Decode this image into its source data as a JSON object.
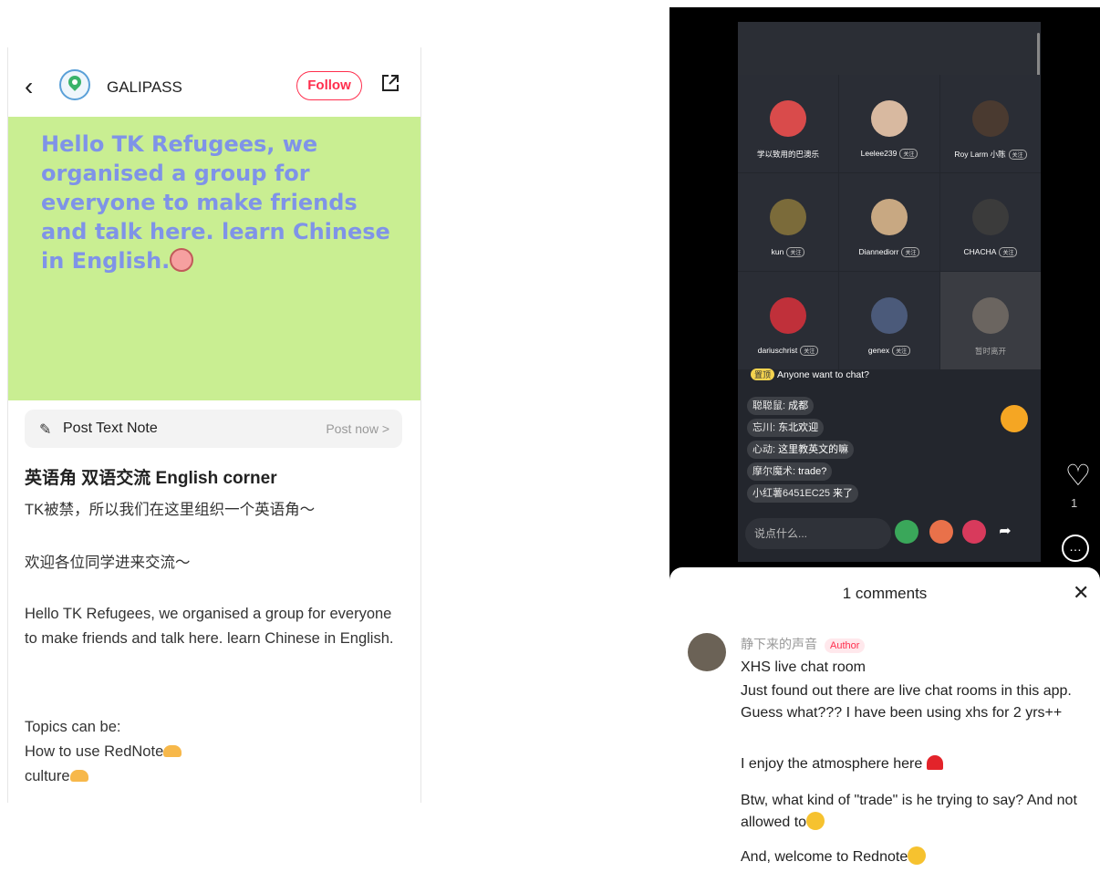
{
  "left": {
    "brand": "GALIPASS",
    "follow_label": "Follow",
    "banner_text": "Hello TK Refugees, we organised a group for everyone to make friends and talk here. learn Chinese in English.",
    "post_label": "Post Text Note",
    "post_now": "Post now >",
    "title": "英语角 双语交流 English corner",
    "p1": "TK被禁，所以我们在这里组织一个英语角～",
    "p2": "欢迎各位同学进来交流～",
    "p3": "Hello TK Refugees, we organised a group for everyone to make friends and talk here. learn Chinese in English.",
    "p4a": "Topics can be:",
    "p4b": "How to use RedNote",
    "p4c": "culture"
  },
  "live": {
    "tiles": [
      {
        "name": "学以致用的巴澳乐",
        "tag": ""
      },
      {
        "name": "Leelee239",
        "tag": "关注"
      },
      {
        "name": "Roy Larm 小陈",
        "tag": "关注"
      },
      {
        "name": "kun",
        "tag": "关注"
      },
      {
        "name": "Diannediorr",
        "tag": "关注"
      },
      {
        "name": "CHACHA",
        "tag": "关注"
      },
      {
        "name": "dariuschrist",
        "tag": "关注"
      },
      {
        "name": "genex",
        "tag": "关注"
      },
      {
        "name": "暂时离开",
        "tag": ""
      }
    ],
    "pin_badge": "置顶",
    "pinned": "Anyone want to chat?",
    "messages": [
      {
        "who": "聪聪鼠:",
        "text": " 成都"
      },
      {
        "who": "忘川:",
        "text": " 东北欢迎"
      },
      {
        "who": "心动:",
        "text": " 这里教英文的嘛"
      },
      {
        "who": "摩尔魔术:",
        "text": " trade?"
      },
      {
        "who": "小红薯6451EC25",
        "text": " 来了"
      }
    ],
    "input_placeholder": "说点什么...",
    "like_count": "1"
  },
  "comments": {
    "title": "1 comments",
    "author_name": "静下来的声音",
    "author_badge": "Author",
    "lines": [
      "XHS live chat room",
      "Just found out there are live chat rooms in this app. Guess what??? I have been using xhs for 2 yrs++",
      "I enjoy the atmosphere here",
      "Btw, what kind of \"trade\" is he trying to say? And not allowed to",
      "And, welcome to Rednote"
    ]
  },
  "colors": {
    "accent": "#ff2e4d",
    "banner_bg": "#c9ee92",
    "banner_text": "#7f93e8",
    "live_bg": "#23262d"
  }
}
